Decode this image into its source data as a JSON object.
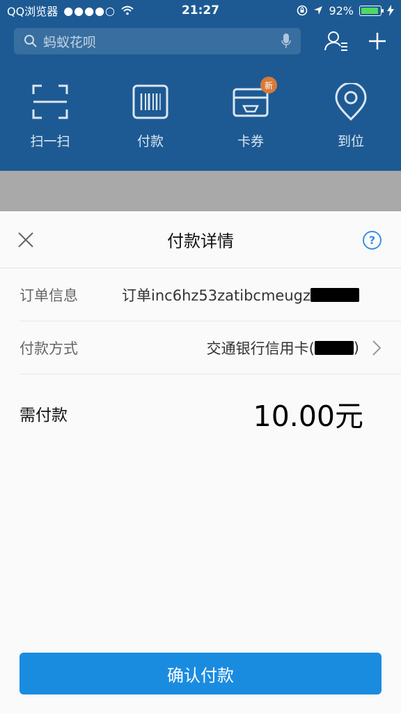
{
  "status": {
    "carrier": "QQ浏览器",
    "time": "21:27",
    "battery": "92%",
    "signal_icon": "signal-dots-icon",
    "wifi_icon": "wifi-icon"
  },
  "search": {
    "placeholder": "蚂蚁花呗"
  },
  "quick": [
    {
      "label": "扫一扫",
      "icon": "scan-icon"
    },
    {
      "label": "付款",
      "icon": "barcode-icon"
    },
    {
      "label": "卡券",
      "icon": "card-icon",
      "badge": "新"
    },
    {
      "label": "到位",
      "icon": "location-icon"
    }
  ],
  "sheet": {
    "title": "付款详情",
    "order_label": "订单信息",
    "order_value": "订单inc6hz53zatibcmeugz",
    "method_label": "付款方式",
    "method_value": "交通银行信用卡(",
    "method_close": ")",
    "amount_label": "需付款",
    "amount_value": "10.00元",
    "help_glyph": "?",
    "confirm_label": "确认付款"
  },
  "colors": {
    "header_blue": "#1d5a93",
    "button_blue": "#1a8ce0",
    "help_blue": "#3a8ee6"
  }
}
